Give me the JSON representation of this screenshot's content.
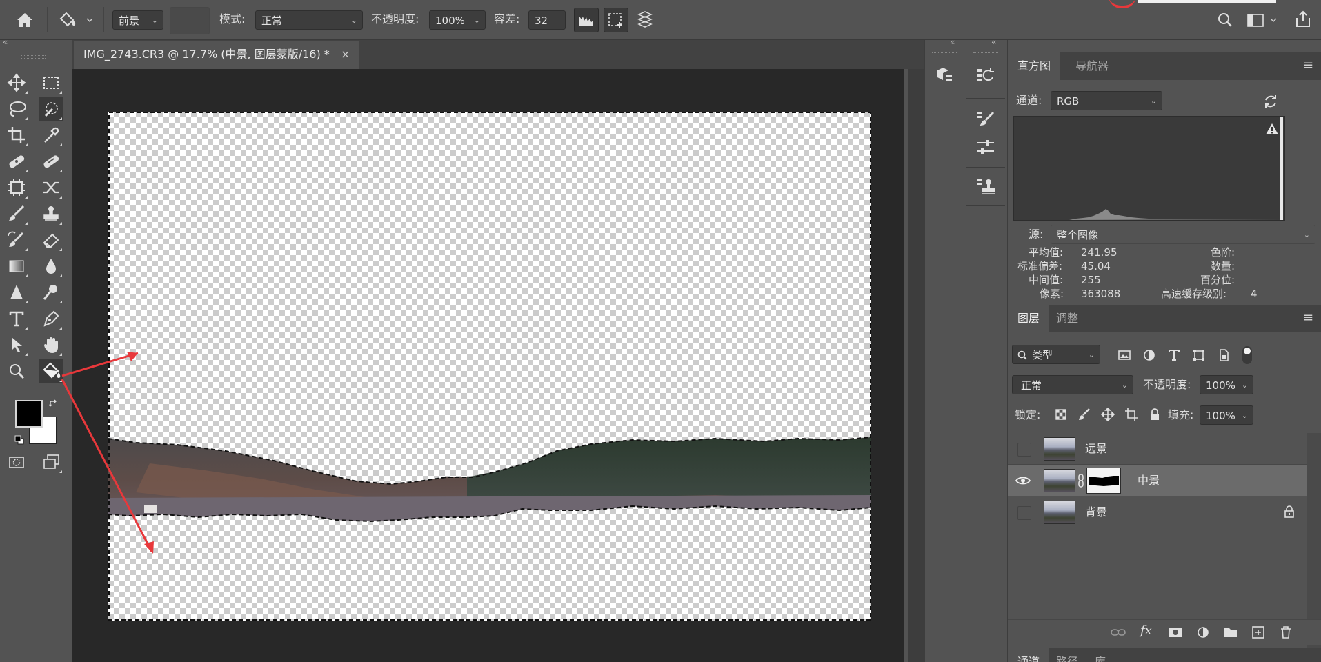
{
  "options_bar": {
    "fill_source": "前景",
    "mode_label": "模式:",
    "mode_value": "正常",
    "opacity_label": "不透明度:",
    "opacity_value": "100%",
    "tolerance_label": "容差:",
    "tolerance_value": "32"
  },
  "document": {
    "tab_title": "IMG_2743.CR3 @ 17.7% (中景, 图层蒙版/16) *",
    "close_glyph": "×"
  },
  "histogram_panel": {
    "tabs": [
      "直方图",
      "导航器"
    ],
    "channel_label": "通道:",
    "channel_value": "RGB",
    "source_label": "源:",
    "source_value": "整个图像",
    "stats": {
      "mean_label": "平均值:",
      "mean": "241.95",
      "std_label": "标准偏差:",
      "std": "45.04",
      "median_label": "中间值:",
      "median": "255",
      "pixels_label": "像素:",
      "pixels": "363088",
      "level_label": "色阶:",
      "count_label": "数量:",
      "percentile_label": "百分位:",
      "cache_label": "高速缓存级别:",
      "cache": "4"
    }
  },
  "layers_panel": {
    "tabs": [
      "图层",
      "调整"
    ],
    "filter_label": "类型",
    "blend_mode": "正常",
    "opacity_label": "不透明度:",
    "opacity_value": "100%",
    "lock_label": "锁定:",
    "fill_label": "填充:",
    "fill_value": "100%",
    "layers": [
      {
        "name": "远景",
        "visible": false,
        "selected": false
      },
      {
        "name": "中景",
        "visible": true,
        "selected": true
      },
      {
        "name": "背景",
        "visible": false,
        "selected": false,
        "locked": true
      }
    ],
    "footer_fx": "fx"
  },
  "bottom_tabs": [
    "通道",
    "路径",
    "库"
  ],
  "colors": {
    "ui_bg": "#535353",
    "canvas_bg": "#282828",
    "annotation_arrow": "#e8383b",
    "foreground": "#000000",
    "background": "#ffffff"
  }
}
